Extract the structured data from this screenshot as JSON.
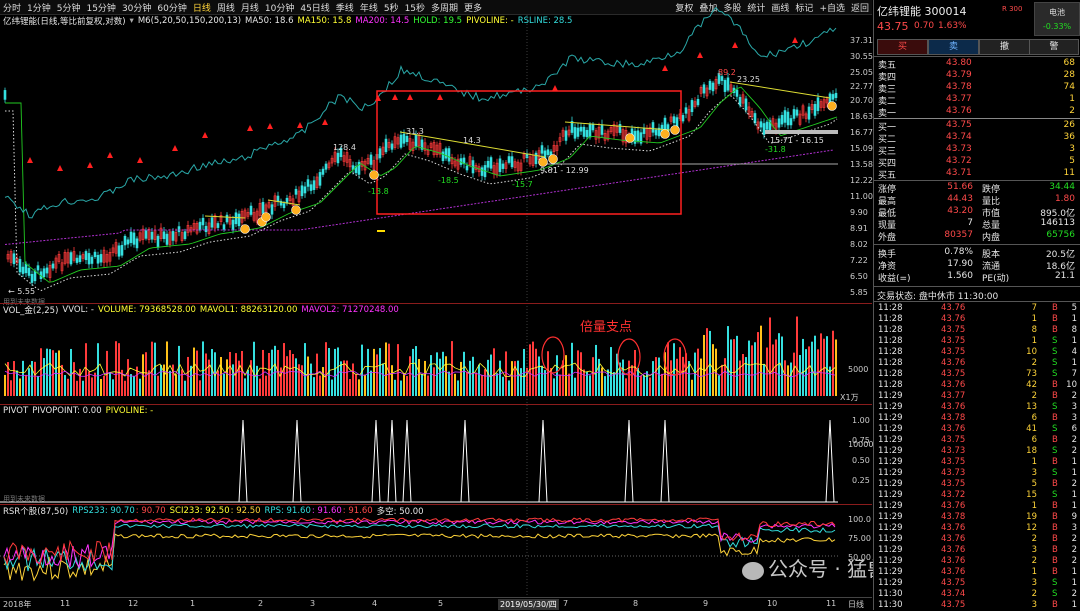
{
  "toolbar": {
    "timeframes": [
      "分时",
      "1分钟",
      "5分钟",
      "15分钟",
      "30分钟",
      "60分钟",
      "日线",
      "周线",
      "月线",
      "10分钟",
      "45日线",
      "季线",
      "年线",
      "5秒",
      "15秒",
      "多周期",
      "更多"
    ],
    "active_timeframe": "日线",
    "tools": [
      "复权",
      "叠加",
      "多股",
      "统计",
      "画线",
      "标记",
      "+自选",
      "返回"
    ]
  },
  "main_chart": {
    "title": "亿纬锂能(日线,等比前复权,对数)",
    "ma_label": "M6(5,20,50,150,200,13)",
    "ma50": "MA50: 18.6",
    "ma150": "MA150: 15.8",
    "ma200": "MA200: 14.5",
    "hold": "HOLD: 19.5",
    "pivoline": "PIVOLINE: -",
    "rsline": "RSLINE: 28.5",
    "price_axis": [
      "37.31",
      "30.55",
      "25.05",
      "22.77",
      "20.70",
      "18.63",
      "16.77",
      "15.09",
      "13.58",
      "12.22",
      "11.00",
      "9.90",
      "8.91",
      "8.02",
      "7.22",
      "6.50",
      "5.85"
    ],
    "annotations": [
      "128.4",
      "-13.8",
      "31.3",
      "14.3",
      "-18.5",
      "-15.7",
      "9.81 - 12.99",
      "89.2",
      "23.25",
      "15.71 - 16.15",
      "-31.8",
      "5.55"
    ],
    "low_marker": "← 5.55",
    "footer_note": "用到未来数据"
  },
  "vol_panel": {
    "title": "VOL_金(2,25)",
    "vvol": "VVOL: -",
    "volume": "VOLUME: 79368528.00",
    "mavol1": "MAVOL1: 88263120.00",
    "mavol2": "MAVOL2: 71270248.00",
    "axis": [
      "10000",
      "5000",
      "X1万"
    ],
    "annotation": "倍量支点"
  },
  "pivot_panel": {
    "title": "PIVOT",
    "pivopoint": "PIVOPOINT: 0.00",
    "pivoline": "PIVOLINE: -",
    "axis": [
      "1.00",
      "0.75",
      "0.50",
      "0.25"
    ],
    "footer_note": "用到未来数据"
  },
  "rsr_panel": {
    "title": "RSR个股(87,50)",
    "rps233": "RPS233: 90.70",
    "rps233b": ": 90.70",
    "sci233": "SCI233: 92.50",
    "sci233b": ": 92.50",
    "rps": "RPS: 91.60",
    "rpsb": ": 91.60",
    "rpsc": ": 91.60",
    "duokong": "多空: 50.00",
    "axis": [
      "100.0",
      "75.00",
      "50.00"
    ]
  },
  "date_axis": {
    "labels": [
      "2018年",
      "11",
      "12",
      "1",
      "2",
      "3",
      "4",
      "5",
      "2019/05/30/四",
      "7",
      "8",
      "9",
      "10",
      "11"
    ],
    "period": "日线"
  },
  "watermark": "公众号 · 猛兽派选股",
  "quote": {
    "name_code": "亿纬锂能 300014",
    "badge": "R 300",
    "price": "43.75",
    "change": "0.70",
    "pct": "1.63%",
    "sector": "电池",
    "sector_pct": "-0.33%",
    "buttons": [
      "买",
      "卖",
      "撤",
      "警"
    ],
    "asks": [
      {
        "label": "卖五",
        "price": "43.80",
        "vol": "68"
      },
      {
        "label": "卖四",
        "price": "43.79",
        "vol": "28"
      },
      {
        "label": "卖三",
        "price": "43.78",
        "vol": "74"
      },
      {
        "label": "卖二",
        "price": "43.77",
        "vol": "1"
      },
      {
        "label": "卖一",
        "price": "43.76",
        "vol": "2"
      }
    ],
    "bids": [
      {
        "label": "买一",
        "price": "43.75",
        "vol": "26"
      },
      {
        "label": "买二",
        "price": "43.74",
        "vol": "36"
      },
      {
        "label": "买三",
        "price": "43.73",
        "vol": "3"
      },
      {
        "label": "买四",
        "price": "43.72",
        "vol": "5"
      },
      {
        "label": "买五",
        "price": "43.71",
        "vol": "11"
      }
    ],
    "stats": [
      {
        "k1": "涨停",
        "v1": "51.66",
        "k2": "跌停",
        "v2": "34.44",
        "c1": "red",
        "c2": "green"
      },
      {
        "k1": "最高",
        "v1": "44.43",
        "k2": "量比",
        "v2": "1.80",
        "c1": "red",
        "c2": "red"
      },
      {
        "k1": "最低",
        "v1": "43.20",
        "k2": "市值",
        "v2": "895.0亿",
        "c1": "red",
        "c2": "white"
      },
      {
        "k1": "现量",
        "v1": "7",
        "k2": "总量",
        "v2": "146113",
        "c1": "white",
        "c2": "white"
      },
      {
        "k1": "外盘",
        "v1": "80357",
        "k2": "内盘",
        "v2": "65756",
        "c1": "red",
        "c2": "green"
      }
    ],
    "stats2": [
      {
        "k1": "换手",
        "v1": "0.78%",
        "k2": "股本",
        "v2": "20.5亿"
      },
      {
        "k1": "净资",
        "v1": "17.90",
        "k2": "流通",
        "v2": "18.6亿"
      },
      {
        "k1": "收益(=)",
        "v1": "1.560",
        "k2": "PE(动)",
        "v2": "21.1"
      }
    ],
    "trade_status": "交易状态: 盘中休市 11:30:00"
  },
  "ticks": [
    {
      "t": "11:28",
      "p": "43.76",
      "v": "7",
      "d": "B",
      "n": "5"
    },
    {
      "t": "11:28",
      "p": "43.76",
      "v": "1",
      "d": "B",
      "n": "1"
    },
    {
      "t": "11:28",
      "p": "43.75",
      "v": "8",
      "d": "B",
      "n": "8"
    },
    {
      "t": "11:28",
      "p": "43.75",
      "v": "1",
      "d": "S",
      "n": "1"
    },
    {
      "t": "11:28",
      "p": "43.75",
      "v": "10",
      "d": "S",
      "n": "4"
    },
    {
      "t": "11:28",
      "p": "43.76",
      "v": "2",
      "d": "S",
      "n": "1"
    },
    {
      "t": "11:28",
      "p": "43.75",
      "v": "73",
      "d": "S",
      "n": "7"
    },
    {
      "t": "11:28",
      "p": "43.76",
      "v": "42",
      "d": "B",
      "n": "10"
    },
    {
      "t": "11:29",
      "p": "43.77",
      "v": "2",
      "d": "B",
      "n": "2"
    },
    {
      "t": "11:29",
      "p": "43.76",
      "v": "13",
      "d": "S",
      "n": "3"
    },
    {
      "t": "11:29",
      "p": "43.78",
      "v": "6",
      "d": "B",
      "n": "3"
    },
    {
      "t": "11:29",
      "p": "43.76",
      "v": "41",
      "d": "S",
      "n": "6"
    },
    {
      "t": "11:29",
      "p": "43.75",
      "v": "6",
      "d": "B",
      "n": "2"
    },
    {
      "t": "11:29",
      "p": "43.73",
      "v": "18",
      "d": "S",
      "n": "2"
    },
    {
      "t": "11:29",
      "p": "43.75",
      "v": "1",
      "d": "B",
      "n": "1"
    },
    {
      "t": "11:29",
      "p": "43.73",
      "v": "3",
      "d": "S",
      "n": "1"
    },
    {
      "t": "11:29",
      "p": "43.75",
      "v": "5",
      "d": "B",
      "n": "2"
    },
    {
      "t": "11:29",
      "p": "43.72",
      "v": "15",
      "d": "S",
      "n": "1"
    },
    {
      "t": "11:29",
      "p": "43.76",
      "v": "1",
      "d": "B",
      "n": "1"
    },
    {
      "t": "11:29",
      "p": "43.78",
      "v": "19",
      "d": "B",
      "n": "9"
    },
    {
      "t": "11:29",
      "p": "43.76",
      "v": "12",
      "d": "B",
      "n": "3"
    },
    {
      "t": "11:29",
      "p": "43.76",
      "v": "2",
      "d": "B",
      "n": "2"
    },
    {
      "t": "11:29",
      "p": "43.76",
      "v": "3",
      "d": "B",
      "n": "2"
    },
    {
      "t": "11:29",
      "p": "43.76",
      "v": "2",
      "d": "B",
      "n": "2"
    },
    {
      "t": "11:29",
      "p": "43.76",
      "v": "1",
      "d": "B",
      "n": "1"
    },
    {
      "t": "11:29",
      "p": "43.75",
      "v": "3",
      "d": "S",
      "n": "1"
    },
    {
      "t": "11:30",
      "p": "43.74",
      "v": "2",
      "d": "S",
      "n": "2"
    },
    {
      "t": "11:30",
      "p": "43.75",
      "v": "3",
      "d": "B",
      "n": "1"
    }
  ]
}
